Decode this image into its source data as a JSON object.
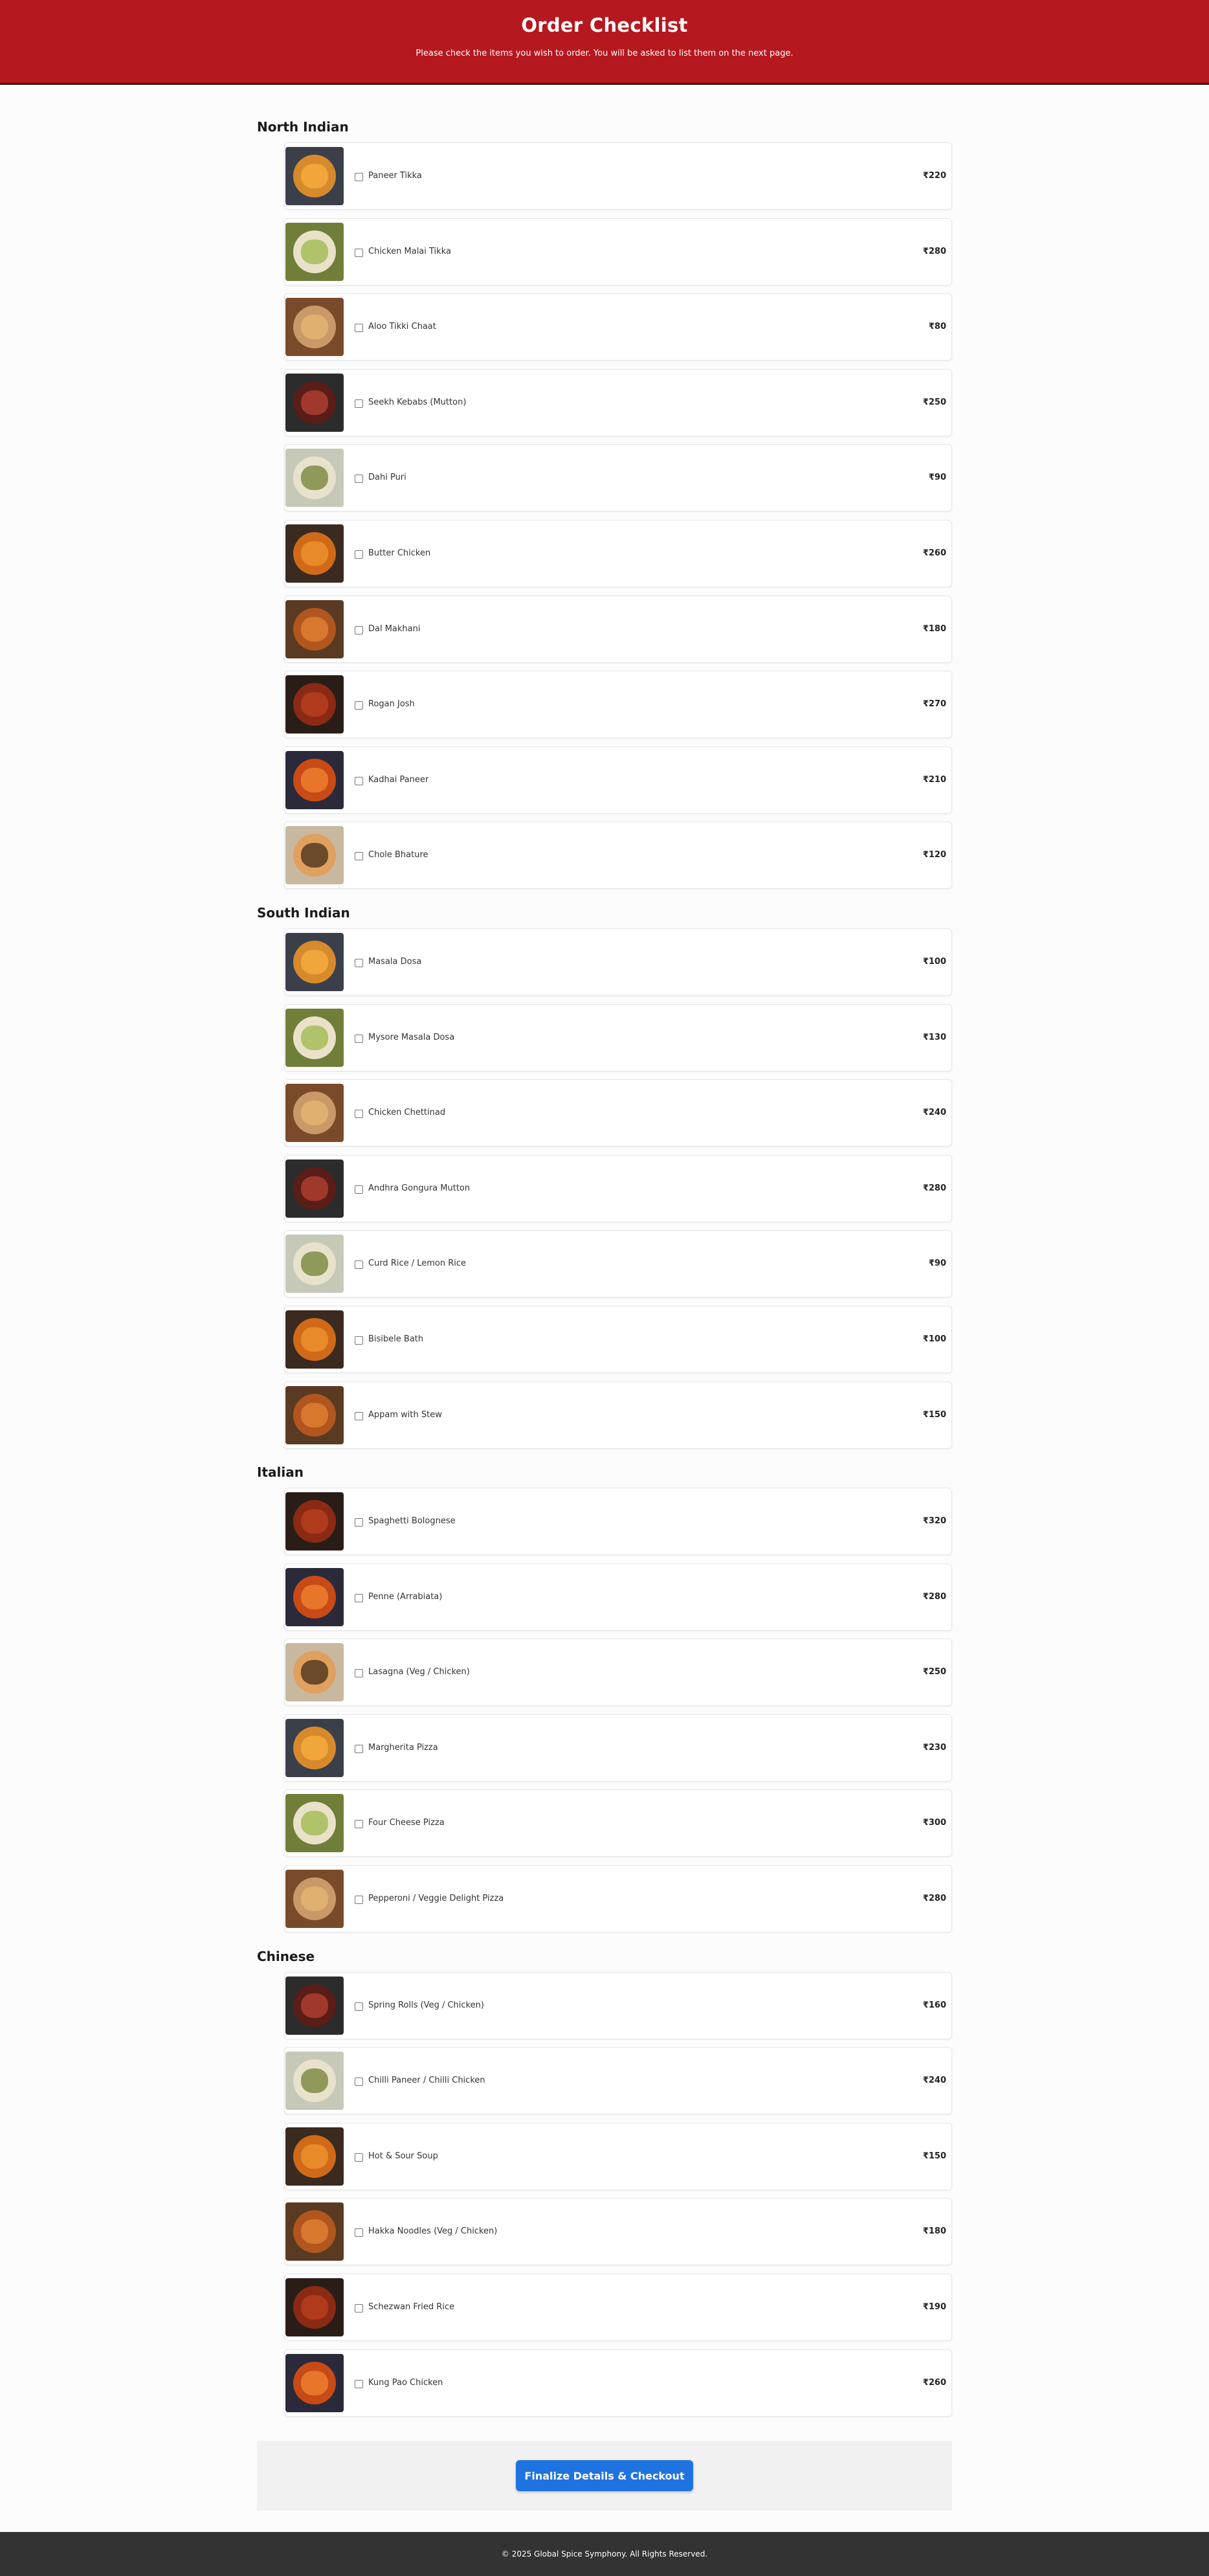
{
  "header": {
    "title": "Order Checklist",
    "subtitle": "Please check the items you wish to order. You will be asked to list them on the next page."
  },
  "colors": {
    "header_bg": "#b5181f",
    "button_bg": "#1f73e0",
    "footer_bg": "#333333"
  },
  "categories": [
    {
      "title": "North Indian",
      "items": [
        {
          "name": "Paneer Tikka",
          "price": "₹220",
          "image": "paneer-tikka-photo"
        },
        {
          "name": "Chicken Malai Tikka",
          "price": "₹280",
          "image": "chicken-malai-tikka-photo"
        },
        {
          "name": "Aloo Tikki Chaat",
          "price": "₹80",
          "image": "aloo-tikki-chaat-photo"
        },
        {
          "name": "Seekh Kebabs (Mutton)",
          "price": "₹250",
          "image": "seekh-kebabs-photo"
        },
        {
          "name": "Dahi Puri",
          "price": "₹90",
          "image": "dahi-puri-photo"
        },
        {
          "name": "Butter Chicken",
          "price": "₹260",
          "image": "butter-chicken-photo"
        },
        {
          "name": "Dal Makhani",
          "price": "₹180",
          "image": "dal-makhani-photo"
        },
        {
          "name": "Rogan Josh",
          "price": "₹270",
          "image": "rogan-josh-photo"
        },
        {
          "name": "Kadhai Paneer",
          "price": "₹210",
          "image": "kadhai-paneer-photo"
        },
        {
          "name": "Chole Bhature",
          "price": "₹120",
          "image": "chole-bhature-photo"
        }
      ]
    },
    {
      "title": "South Indian",
      "items": [
        {
          "name": "Masala Dosa",
          "price": "₹100",
          "image": "masala-dosa-photo"
        },
        {
          "name": "Mysore Masala Dosa",
          "price": "₹130",
          "image": "mysore-masala-dosa-photo"
        },
        {
          "name": "Chicken Chettinad",
          "price": "₹240",
          "image": "chicken-chettinad-photo"
        },
        {
          "name": "Andhra Gongura Mutton",
          "price": "₹280",
          "image": "andhra-gongura-mutton-photo"
        },
        {
          "name": "Curd Rice / Lemon Rice",
          "price": "₹90",
          "image": "curd-rice-photo"
        },
        {
          "name": "Bisibele Bath",
          "price": "₹100",
          "image": "bisibele-bath-photo"
        },
        {
          "name": "Appam with Stew",
          "price": "₹150",
          "image": "appam-with-stew-photo"
        }
      ]
    },
    {
      "title": "Italian",
      "items": [
        {
          "name": "Spaghetti Bolognese",
          "price": "₹320",
          "image": "spaghetti-bolognese-photo"
        },
        {
          "name": "Penne (Arrabiata)",
          "price": "₹280",
          "image": "penne-arrabiata-photo"
        },
        {
          "name": "Lasagna (Veg / Chicken)",
          "price": "₹250",
          "image": "lasagna-photo"
        },
        {
          "name": "Margherita Pizza",
          "price": "₹230",
          "image": "margherita-pizza-photo"
        },
        {
          "name": "Four Cheese Pizza",
          "price": "₹300",
          "image": "four-cheese-pizza-photo"
        },
        {
          "name": "Pepperoni / Veggie Delight Pizza",
          "price": "₹280",
          "image": "pepperoni-pizza-photo"
        }
      ]
    },
    {
      "title": "Chinese",
      "items": [
        {
          "name": "Spring Rolls (Veg / Chicken)",
          "price": "₹160",
          "image": "spring-rolls-photo"
        },
        {
          "name": "Chilli Paneer / Chilli Chicken",
          "price": "₹240",
          "image": "chilli-paneer-photo"
        },
        {
          "name": "Hot & Sour Soup",
          "price": "₹150",
          "image": "hot-sour-soup-photo"
        },
        {
          "name": "Hakka Noodles (Veg / Chicken)",
          "price": "₹180",
          "image": "hakka-noodles-photo"
        },
        {
          "name": "Schezwan Fried Rice",
          "price": "₹190",
          "image": "schezwan-fried-rice-photo"
        },
        {
          "name": "Kung Pao Chicken",
          "price": "₹260",
          "image": "kung-pao-chicken-photo"
        }
      ]
    }
  ],
  "checkout": {
    "button_label": "Finalize Details & Checkout"
  },
  "footer": {
    "text": "© 2025 Global Spice Symphony. All Rights Reserved."
  }
}
